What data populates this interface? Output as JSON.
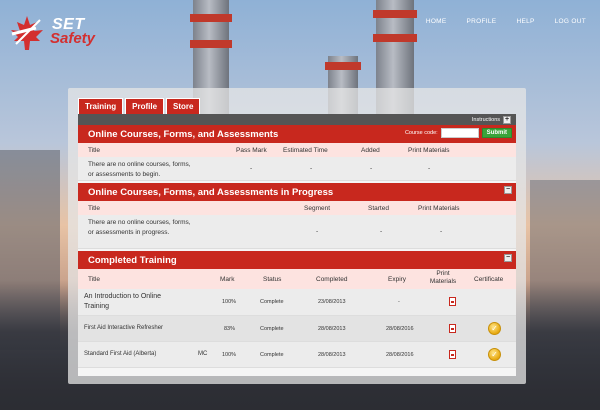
{
  "brand": {
    "line1": "SET",
    "line2": "Safety"
  },
  "topnav": [
    "HOME",
    "PROFILE",
    "HELP",
    "LOG OUT"
  ],
  "tabs": [
    "Training",
    "Profile",
    "Store"
  ],
  "toolbar": {
    "instructions": "Instructions",
    "toggle": "+"
  },
  "online": {
    "title": "Online Courses, Forms, and Assessments",
    "course_code_label": "Course code:",
    "course_code_value": "",
    "submit": "Submit",
    "columns": [
      "Title",
      "Pass Mark",
      "Estimated Time",
      "Added",
      "Print Materials"
    ],
    "empty_message": "There are no online courses, forms, or assessments to begin.",
    "empty_cells": [
      "-",
      "-",
      "-",
      "-"
    ]
  },
  "in_progress": {
    "title": "Online Courses, Forms, and Assessments in Progress",
    "toggle": "−",
    "columns": [
      "Title",
      "Segment",
      "Started",
      "Print Materials"
    ],
    "empty_message": "There are no online courses, forms, or assessments in progress.",
    "empty_cells": [
      "-",
      "-",
      "-"
    ]
  },
  "completed": {
    "title": "Completed Training",
    "toggle": "−",
    "columns": [
      "Title",
      "Mark",
      "Status",
      "Completed",
      "Expiry",
      "Print Materials",
      "Certificate"
    ],
    "rows": [
      {
        "title": "An Introduction to Online Training",
        "tag": "",
        "mark": "100%",
        "status": "Complete",
        "completed": "23/08/2013",
        "expiry": "-",
        "has_print": true,
        "has_certificate": false
      },
      {
        "title": "First Aid Interactive Refresher",
        "tag": "",
        "mark": "83%",
        "status": "Complete",
        "completed": "28/08/2013",
        "expiry": "28/08/2016",
        "has_print": true,
        "has_certificate": true
      },
      {
        "title": "Standard First Aid (Alberta)",
        "tag": "MC",
        "mark": "100%",
        "status": "Complete",
        "completed": "28/08/2013",
        "expiry": "28/08/2016",
        "has_print": true,
        "has_certificate": true
      }
    ]
  },
  "icons": {
    "pdf": "pdf-icon",
    "certificate": "certificate-check-icon",
    "logo": "maple-leaf-logo-icon"
  },
  "colors": {
    "accent": "#c8281e",
    "submit": "#3aa33a",
    "header_row": "#fde3e0"
  }
}
